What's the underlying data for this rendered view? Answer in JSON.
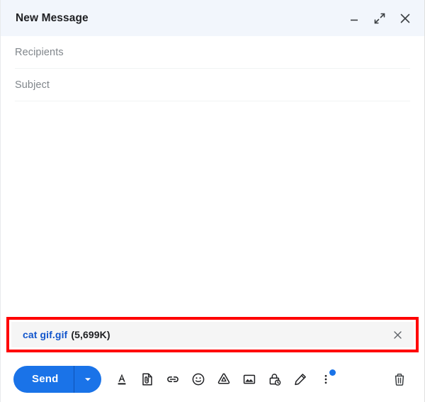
{
  "window": {
    "title": "New Message",
    "header_bg": "#f2f6fc",
    "controls": [
      {
        "name": "minimize",
        "icon": "minimize-icon",
        "label": "Minimize"
      },
      {
        "name": "expand",
        "icon": "expand-icon",
        "label": "Full screen"
      },
      {
        "name": "close",
        "icon": "close-icon",
        "label": "Save & close"
      }
    ]
  },
  "fields": {
    "recipients": {
      "placeholder": "Recipients",
      "value": ""
    },
    "subject": {
      "placeholder": "Subject",
      "value": ""
    }
  },
  "body": {
    "value": ""
  },
  "attachment": {
    "filename": "cat gif.gif",
    "size": "(5,699K)",
    "remove_icon": "close-icon",
    "chip_bg": "#f5f5f5",
    "name_color": "#1155cc",
    "highlight_color": "#ff0000"
  },
  "toolbar": {
    "send_label": "Send",
    "send_color": "#1a73e8",
    "send_options_icon": "chevron-down-icon",
    "tools": [
      {
        "name": "formatting-options",
        "icon": "format-text-icon",
        "label": "Formatting options"
      },
      {
        "name": "attach-files",
        "icon": "attach-file-icon",
        "label": "Attach files"
      },
      {
        "name": "insert-link",
        "icon": "link-icon",
        "label": "Insert link"
      },
      {
        "name": "insert-emoji",
        "icon": "emoji-icon",
        "label": "Insert emoji"
      },
      {
        "name": "insert-drive-file",
        "icon": "google-drive-icon",
        "label": "Insert files using Drive"
      },
      {
        "name": "insert-photo",
        "icon": "image-icon",
        "label": "Insert photo"
      },
      {
        "name": "confidential-mode",
        "icon": "lock-clock-icon",
        "label": "Toggle confidential mode"
      },
      {
        "name": "insert-signature",
        "icon": "pen-icon",
        "label": "Insert signature"
      },
      {
        "name": "more-options",
        "icon": "more-vert-icon",
        "label": "More options",
        "badge": true
      }
    ],
    "discard_label": "Discard draft",
    "discard_icon": "trash-icon"
  }
}
